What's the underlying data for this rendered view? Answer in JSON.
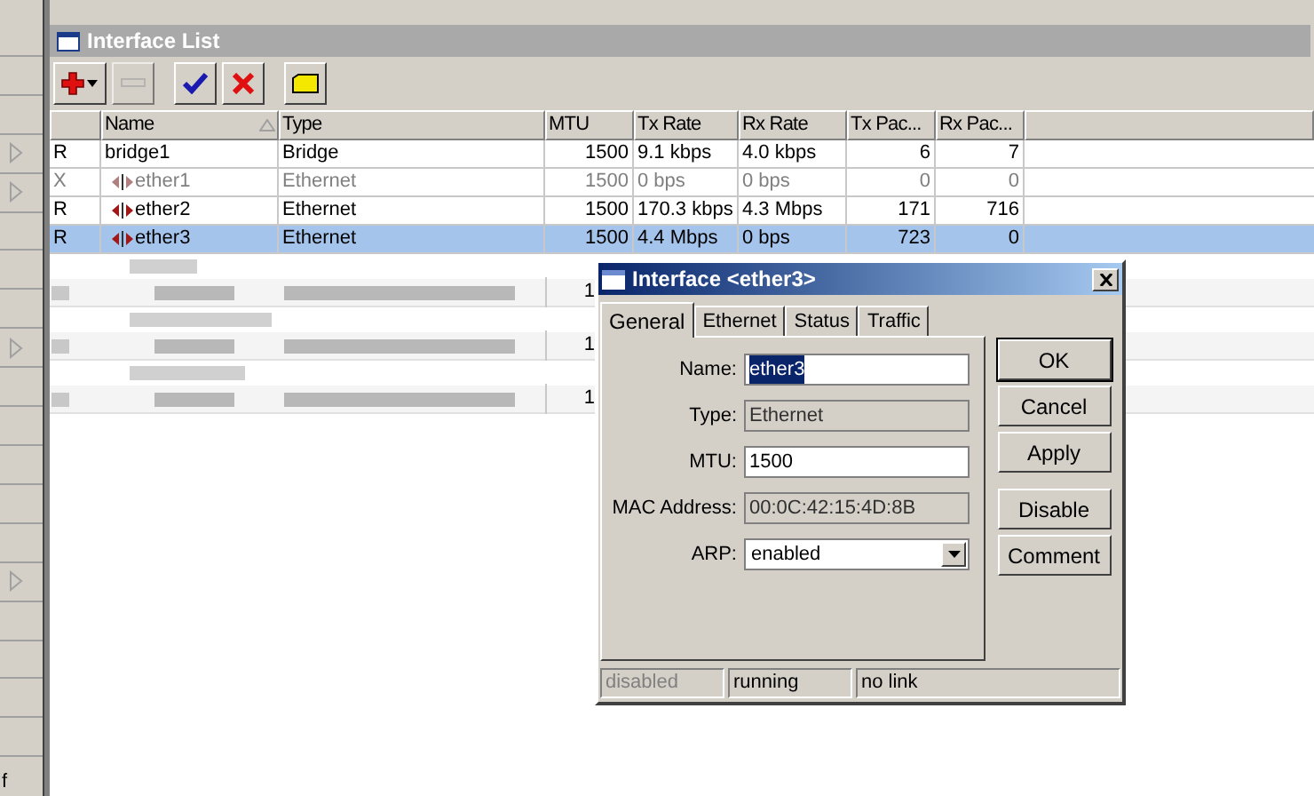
{
  "sidebar": {
    "items": [
      {
        "has_submenu": false
      },
      {
        "has_submenu": false
      },
      {
        "has_submenu": false
      },
      {
        "has_submenu": true
      },
      {
        "has_submenu": true
      },
      {
        "has_submenu": false
      },
      {
        "has_submenu": false
      },
      {
        "has_submenu": false
      },
      {
        "has_submenu": true
      },
      {
        "has_submenu": false
      },
      {
        "has_submenu": false
      },
      {
        "has_submenu": false
      },
      {
        "has_submenu": false
      },
      {
        "has_submenu": false
      },
      {
        "has_submenu": true
      },
      {
        "has_submenu": false
      },
      {
        "has_submenu": false
      },
      {
        "has_submenu": false
      },
      {
        "has_submenu": false
      },
      {
        "has_submenu": false,
        "label": "f"
      }
    ]
  },
  "window": {
    "title": "Interface List"
  },
  "toolbar": [
    {
      "kind": "add",
      "disabled": false
    },
    {
      "kind": "remove",
      "disabled": true
    },
    {
      "kind": "enable",
      "disabled": false
    },
    {
      "kind": "disable",
      "disabled": false
    },
    {
      "kind": "comment",
      "disabled": false
    }
  ],
  "table": {
    "columns": [
      {
        "sorted": false
      },
      {
        "label": "Name",
        "sorted": true
      },
      {
        "label": "Type",
        "sorted": false
      },
      {
        "label": "MTU",
        "sorted": false
      },
      {
        "label": "Tx Rate",
        "sorted": false
      },
      {
        "label": "Rx Rate",
        "sorted": false
      },
      {
        "label": "Tx Pac...",
        "sorted": false
      },
      {
        "label": "Rx Pac...",
        "sorted": false
      }
    ],
    "rows": [
      {
        "flag": "R",
        "kind": "bridge",
        "name": "bridge1",
        "type": "Bridge",
        "mtu": "1500",
        "tx_rate": "9.1 kbps",
        "rx_rate": "4.0 kbps",
        "tx_packets": "6",
        "rx_packets": "7",
        "disabled": false,
        "selected": false
      },
      {
        "flag": "X",
        "kind": "ethernet",
        "name": "ether1",
        "type": "Ethernet",
        "mtu": "1500",
        "tx_rate": "0 bps",
        "rx_rate": "0 bps",
        "tx_packets": "0",
        "rx_packets": "0",
        "disabled": true,
        "selected": false
      },
      {
        "flag": "R",
        "kind": "ethernet",
        "name": "ether2",
        "type": "Ethernet",
        "mtu": "1500",
        "tx_rate": "170.3 kbps",
        "rx_rate": "4.3 Mbps",
        "tx_packets": "171",
        "rx_packets": "716",
        "disabled": false,
        "selected": false
      },
      {
        "flag": "R",
        "kind": "ethernet",
        "name": "ether3",
        "type": "Ethernet",
        "mtu": "1500",
        "tx_rate": "4.4 Mbps",
        "rx_rate": "0 bps",
        "tx_packets": "723",
        "rx_packets": "0",
        "disabled": false,
        "selected": true
      }
    ],
    "redacted_rows": [
      {
        "kind": "group"
      },
      {
        "kind": "item",
        "mtu": "1"
      },
      {
        "kind": "group"
      },
      {
        "kind": "item",
        "mtu": "1"
      },
      {
        "kind": "group"
      },
      {
        "kind": "item",
        "mtu": "1"
      }
    ]
  },
  "dialog": {
    "title": "Interface <ether3>",
    "tabs": [
      {
        "label": "General",
        "selected": true
      },
      {
        "label": "Ethernet",
        "selected": false
      },
      {
        "label": "Status",
        "selected": false
      },
      {
        "label": "Traffic",
        "selected": false
      }
    ],
    "fields": [
      {
        "label": "Name:",
        "value": "ether3",
        "kind": "text",
        "selected": true
      },
      {
        "label": "Type:",
        "value": "Ethernet",
        "kind": "readonly",
        "selected": false
      },
      {
        "label": "MTU:",
        "value": "1500",
        "kind": "text",
        "selected": false
      },
      {
        "label": "MAC Address:",
        "value": "00:0C:42:15:4D:8B",
        "kind": "readonly",
        "selected": false
      },
      {
        "label": "ARP:",
        "value": "enabled",
        "kind": "select",
        "selected": false
      }
    ],
    "buttons": [
      {
        "label": "OK",
        "default": true
      },
      {
        "label": "Cancel",
        "default": false
      },
      {
        "label": "Apply",
        "default": false
      },
      {
        "label": "Disable",
        "default": false
      },
      {
        "label": "Comment",
        "default": false
      }
    ],
    "status_bar": [
      {
        "text": "disabled",
        "dimmed": true
      },
      {
        "text": "running",
        "dimmed": false
      },
      {
        "text": "no link",
        "dimmed": false
      }
    ]
  }
}
